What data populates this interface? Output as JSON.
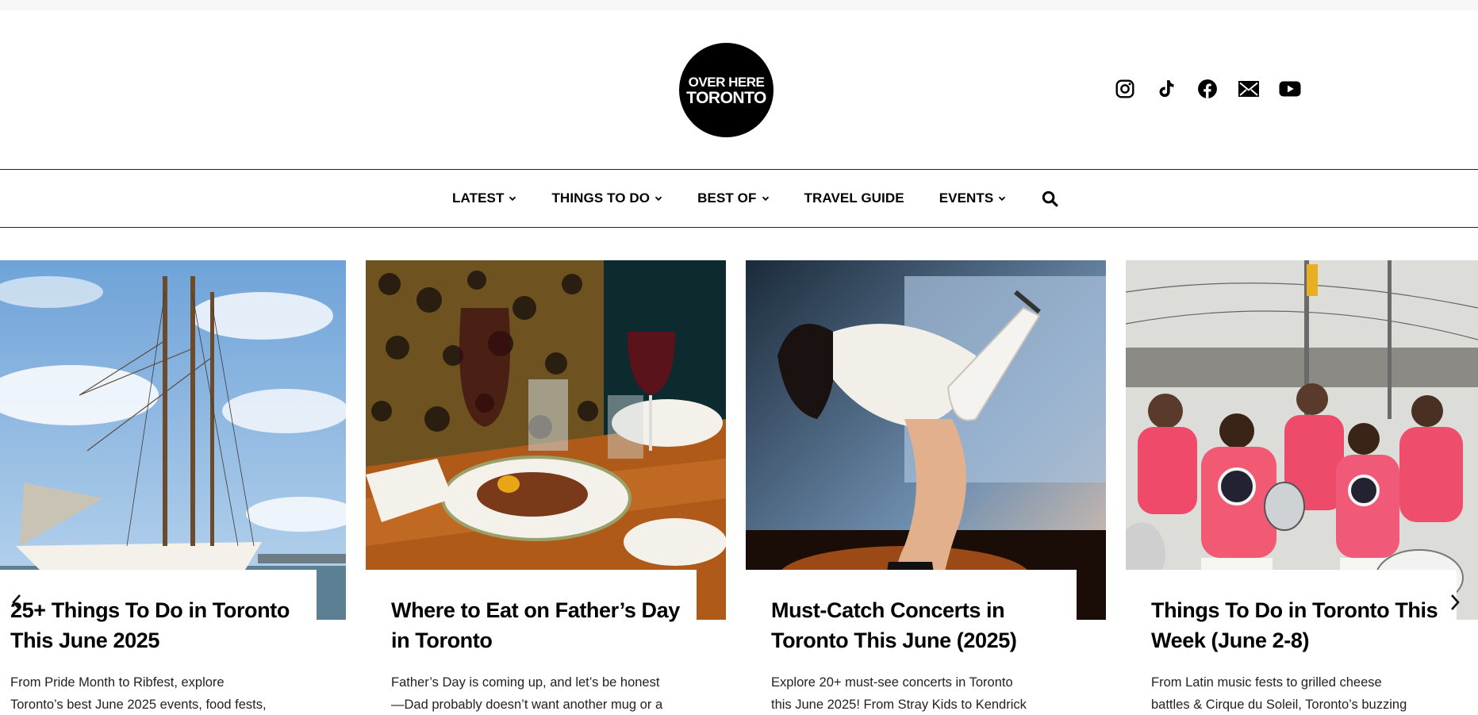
{
  "site": {
    "logo": {
      "line1": "OVER HERE",
      "line2": "TORONTO"
    }
  },
  "social": [
    {
      "icon": "instagram-icon"
    },
    {
      "icon": "tiktok-icon"
    },
    {
      "icon": "facebook-icon"
    },
    {
      "icon": "email-icon"
    },
    {
      "icon": "youtube-icon"
    }
  ],
  "nav": {
    "items": [
      {
        "label": "LATEST",
        "dropdown": true
      },
      {
        "label": "THINGS TO DO",
        "dropdown": true
      },
      {
        "label": "BEST OF",
        "dropdown": true
      },
      {
        "label": "TRAVEL GUIDE",
        "dropdown": false
      },
      {
        "label": "EVENTS",
        "dropdown": true
      }
    ],
    "search_icon": "search-icon"
  },
  "cards": [
    {
      "title": "25+ Things To Do in Toronto This June 2025",
      "excerpt_line1": "From Pride Month to Ribfest, explore",
      "excerpt_line2": "Toronto’s best June 2025 events, food fests,"
    },
    {
      "title": "Where to Eat on Father’s Day in Toronto",
      "excerpt_line1": "Father’s Day is coming up, and let’s be honest",
      "excerpt_line2": "—Dad probably doesn’t want another mug or a"
    },
    {
      "title": "Must-Catch Concerts in Toronto This June (2025)",
      "excerpt_line1": "Explore 20+ must-see concerts in Toronto",
      "excerpt_line2": "this June 2025! From Stray Kids to Kendrick"
    },
    {
      "title": "Things To Do in Toronto This Week (June 2-8)",
      "excerpt_line1": "From Latin music fests to grilled cheese",
      "excerpt_line2": "battles & Cirque du Soleil, Toronto’s buzzing"
    }
  ],
  "carousel": {
    "prev_icon": "chevron-left-icon",
    "next_icon": "chevron-right-icon"
  }
}
